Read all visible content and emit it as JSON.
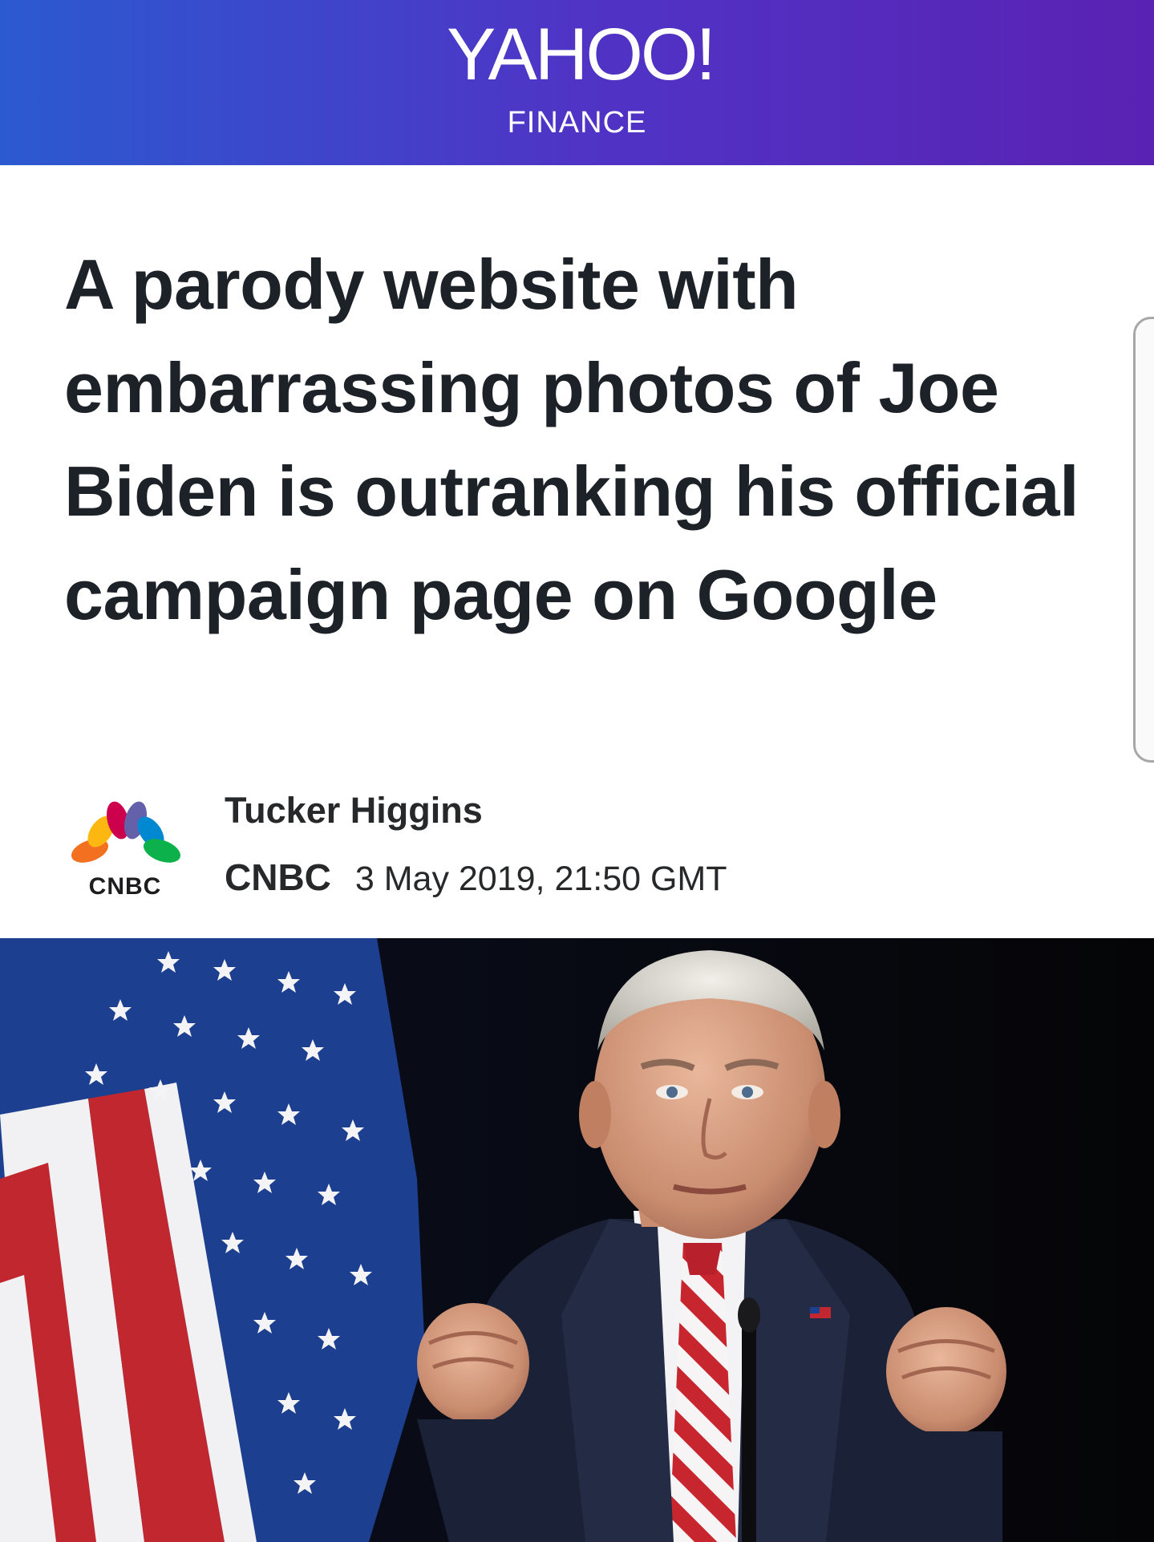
{
  "header": {
    "brand": "YAHOO!",
    "section": "FINANCE",
    "gradient_colors": [
      "#2b5ad0",
      "#4f34c6",
      "#5a22b3"
    ]
  },
  "article": {
    "headline": "A parody website with embarrassing photos of Joe Biden is outranking his official campaign page on Google",
    "author": "Tucker Higgins",
    "provider": "CNBC",
    "timestamp": "3 May 2019, 21:50 GMT",
    "provider_logo_text": "CNBC"
  },
  "hero_image": {
    "description_icon": "hero-photo"
  }
}
